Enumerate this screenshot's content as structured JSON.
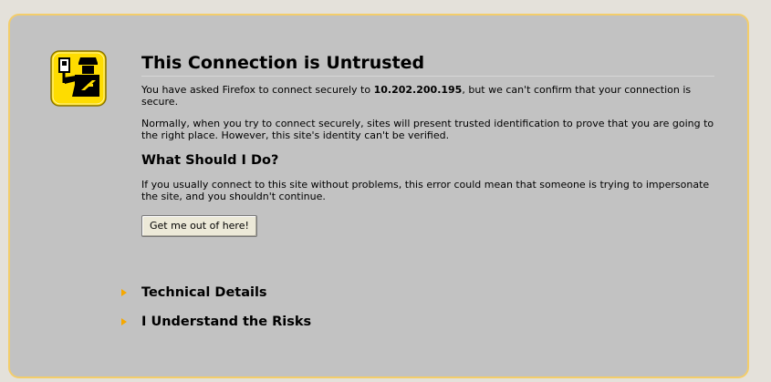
{
  "error_page": {
    "title": "This Connection is Untrusted",
    "intro_prefix": "You have asked Firefox to connect securely to ",
    "host": "10.202.200.195",
    "intro_suffix": ", but we can't confirm that your connection is secure.",
    "normal_text": "Normally, when you try to connect securely, sites will present trusted identification to prove that you are going to the right place. However, this site's identity can't be verified.",
    "what_heading": "What Should I Do?",
    "what_text": "If you usually connect to this site without problems, this error could mean that someone is trying to impersonate the site, and you shouldn't continue.",
    "escape_button": "Get me out of here!",
    "technical_details": "Technical Details",
    "understand_risks": "I Understand the Risks",
    "icon": "policeman-id-badge-icon",
    "colors": {
      "panel": "#c2c2c2",
      "panel_border": "#f3cd6a",
      "background": "#e4e1da",
      "icon_yellow": "#fedc00",
      "arrow": "#f6a800"
    }
  }
}
